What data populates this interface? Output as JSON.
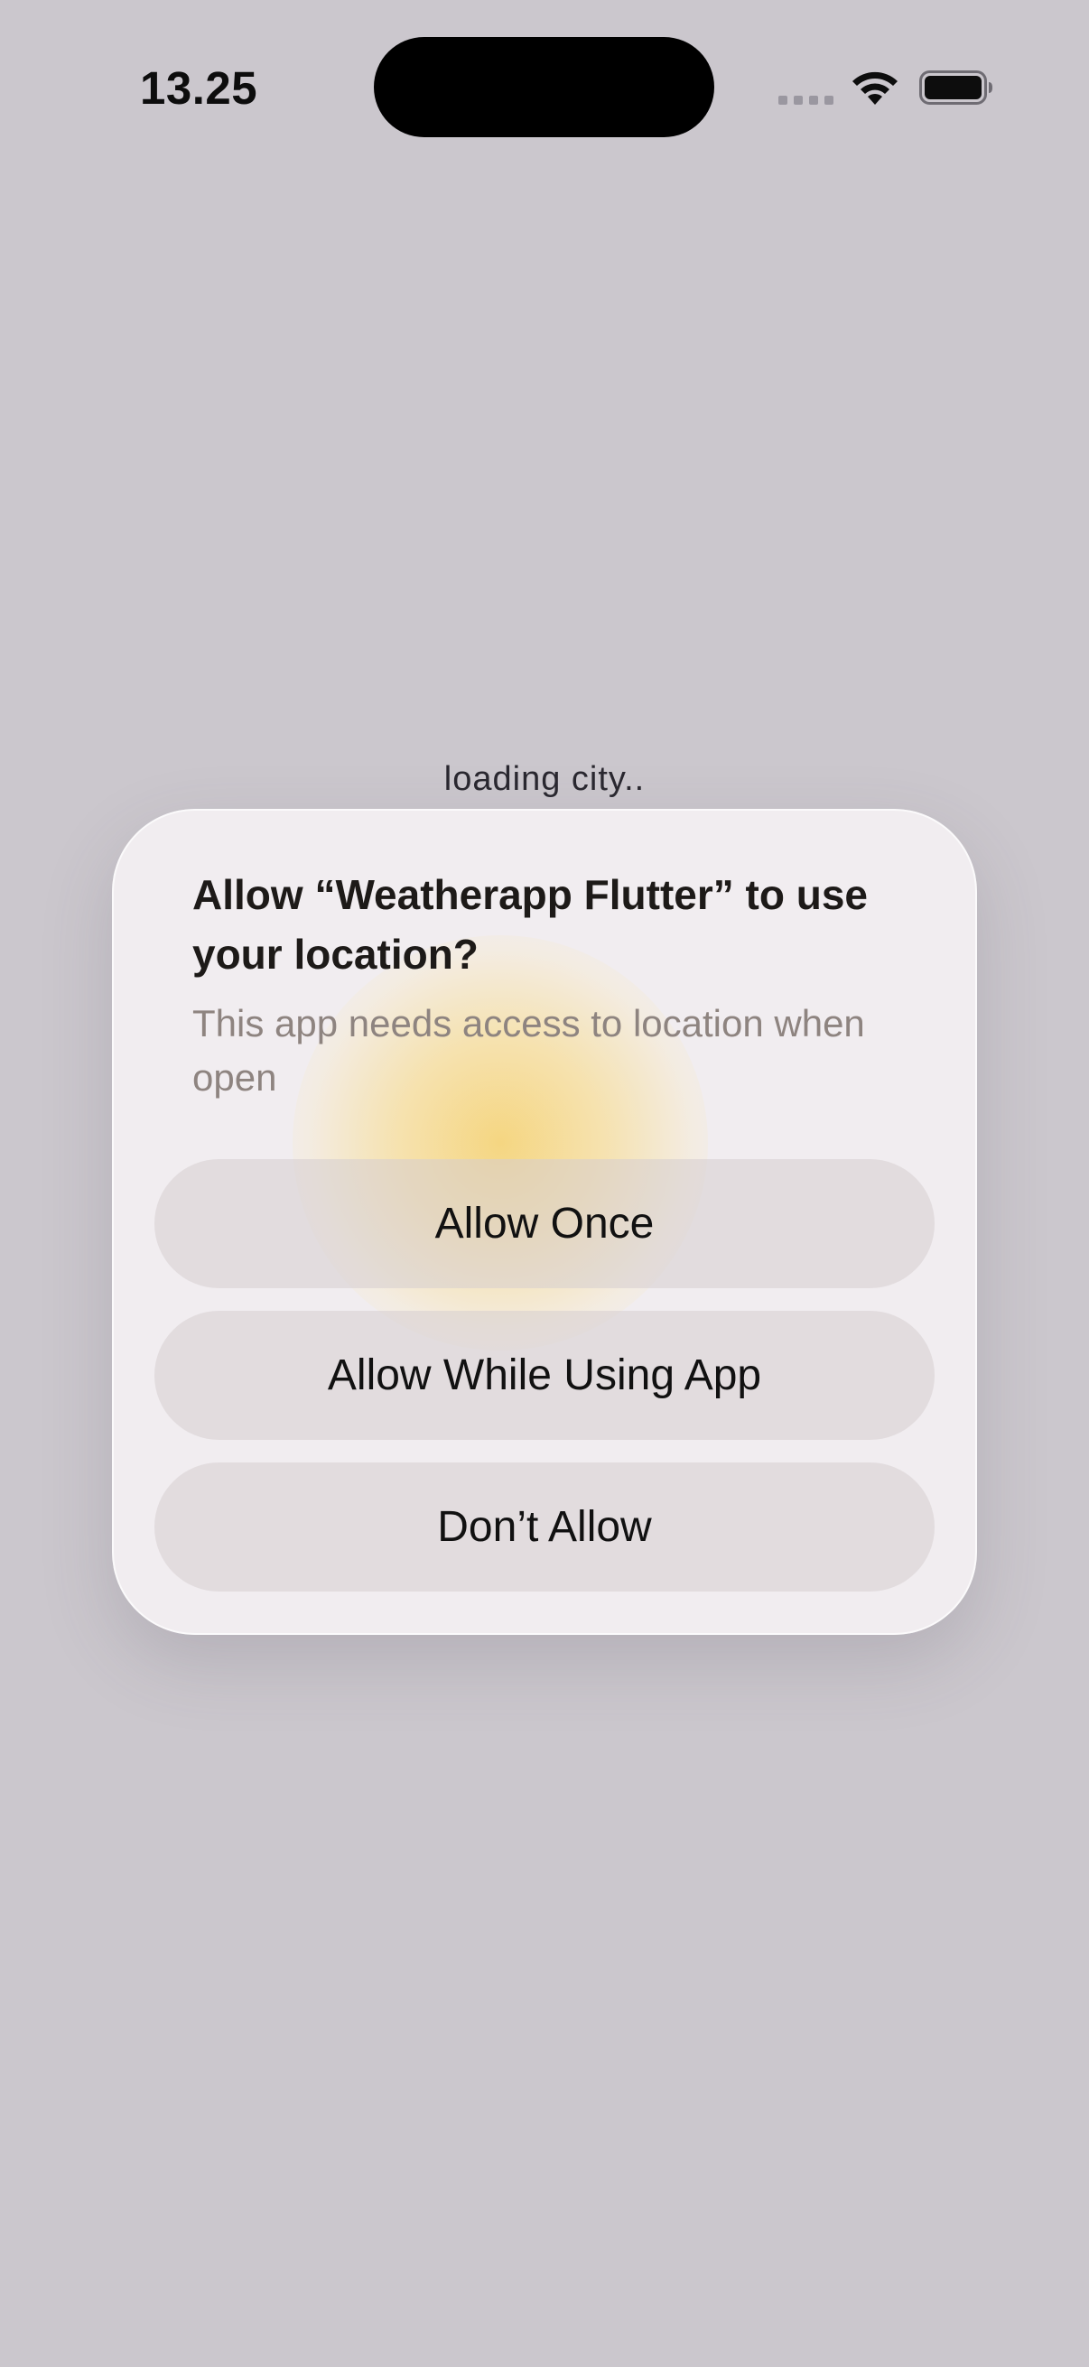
{
  "status_bar": {
    "time": "13.25",
    "icons": [
      "cellular-signal-icon",
      "wifi-icon",
      "battery-icon"
    ]
  },
  "app": {
    "loading_text": "loading city.."
  },
  "alert": {
    "title": "Allow “Weatherapp Flutter” to use your location?",
    "message": "This app needs access to location when  open",
    "buttons": {
      "allow_once": "Allow Once",
      "allow_while_using": "Allow While Using App",
      "dont_allow": "Don’t Allow"
    }
  },
  "colors": {
    "background": "#cbc7cd",
    "alert_background": "#f1edf0",
    "glow": "#f6d26e",
    "button_fill": "#d6ced0"
  }
}
